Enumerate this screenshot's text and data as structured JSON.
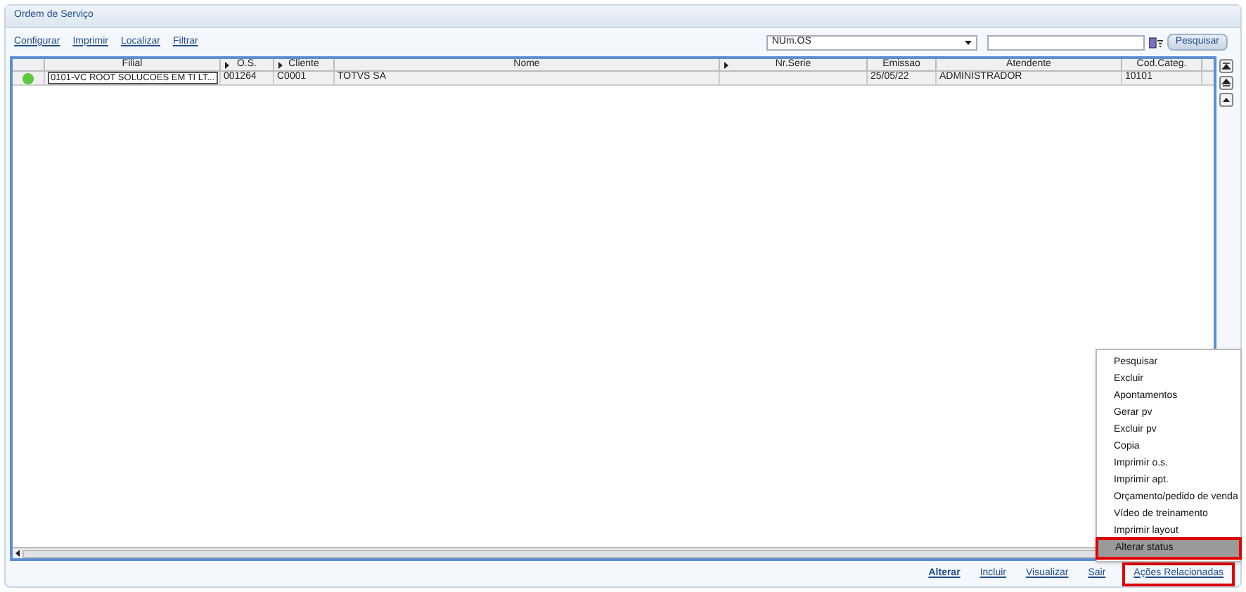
{
  "window": {
    "title": "Ordem de Serviço"
  },
  "links": [
    "Configurar",
    "Imprimir",
    "Localizar",
    "Filtrar"
  ],
  "search": {
    "field": "NUm.OS",
    "button": "Pesquisar"
  },
  "table": {
    "columns": [
      {
        "label": "Filial",
        "marker": false
      },
      {
        "label": "O.S.",
        "marker": true
      },
      {
        "label": "Cliente",
        "marker": true
      },
      {
        "label": "Nome",
        "marker": false
      },
      {
        "label": "Nr.Serie",
        "marker": true
      },
      {
        "label": "Emissao",
        "marker": false
      },
      {
        "label": "Atendente",
        "marker": false
      },
      {
        "label": "Cod.Categ.",
        "marker": false
      }
    ],
    "rows": [
      {
        "color": "#5cc93a",
        "cells": [
          "0101-VC ROOT SOLUCOES EM TI LT...",
          "001264",
          "C0001",
          "TOTVS SA",
          "",
          "25/05/22",
          "ADMINISTRADOR",
          "10101"
        ]
      }
    ]
  },
  "menu": [
    {
      "label": "Pesquisar",
      "selected": false
    },
    {
      "label": "Excluir",
      "selected": false
    },
    {
      "label": "Apontamentos",
      "selected": false
    },
    {
      "label": "Gerar pv",
      "selected": false
    },
    {
      "label": "Excluir pv",
      "selected": false
    },
    {
      "label": "Copia",
      "selected": false
    },
    {
      "label": "Imprimir o.s.",
      "selected": false
    },
    {
      "label": "Imprimir apt.",
      "selected": false
    },
    {
      "label": "Orçamento/pedido de venda",
      "selected": false
    },
    {
      "label": "Vídeo de treinamento",
      "selected": false
    },
    {
      "label": "Imprimir layout",
      "selected": false
    },
    {
      "label": "Alterar status",
      "selected": true
    }
  ],
  "buttons": [
    {
      "label": "Alterar",
      "highlighted": false
    },
    {
      "label": "Incluir",
      "highlighted": false
    },
    {
      "label": "Visualizar",
      "highlighted": false
    },
    {
      "label": "Sair",
      "highlighted": false
    },
    {
      "label": "Ações Relacionadas",
      "highlighted": true
    }
  ]
}
